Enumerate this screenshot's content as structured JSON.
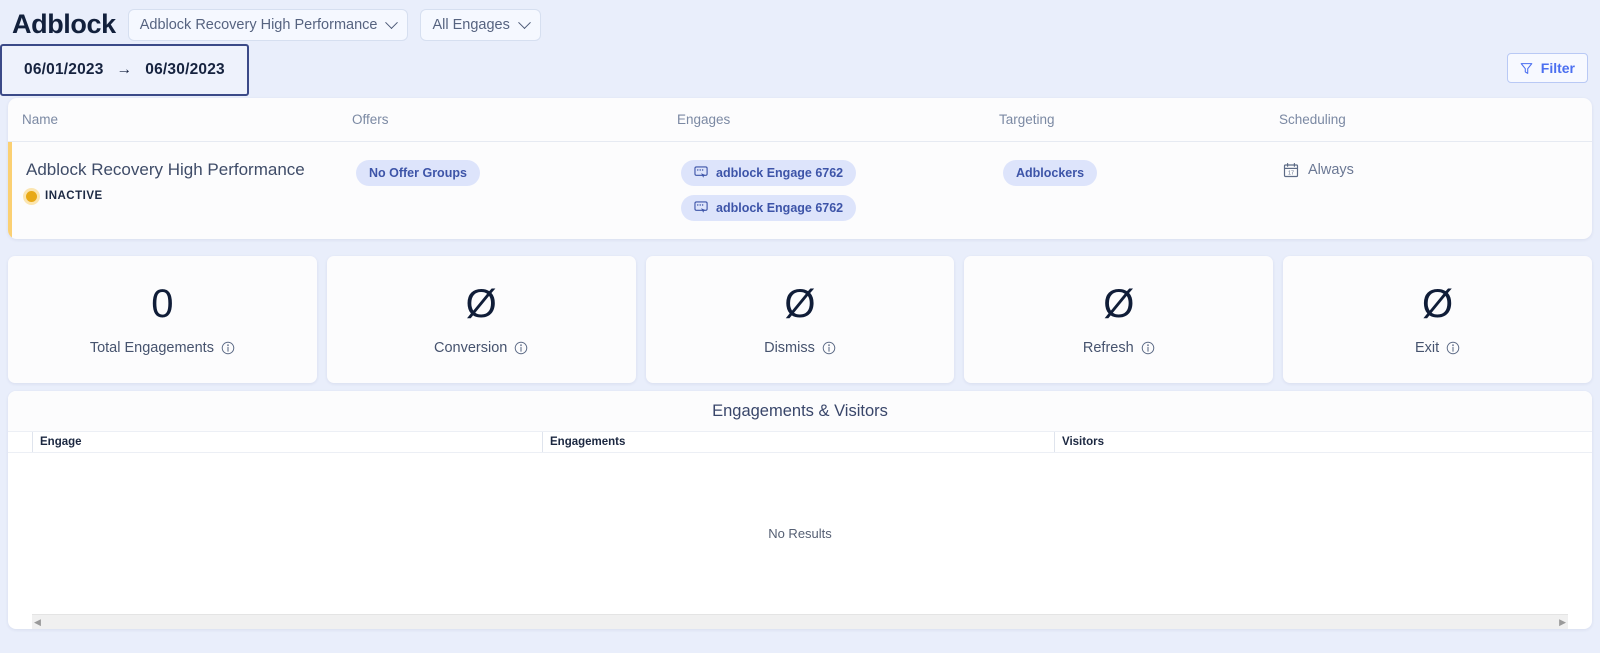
{
  "header": {
    "app_title": "Adblock",
    "campaign_select": "Adblock Recovery High Performance",
    "engage_select": "All Engages",
    "date_start": "06/01/2023",
    "date_arrow": "→",
    "date_end": "06/30/2023",
    "filter_label": "Filter"
  },
  "table": {
    "columns": [
      "Name",
      "Offers",
      "Engages",
      "Targeting",
      "Scheduling"
    ],
    "row": {
      "name": "Adblock Recovery High Performance",
      "status": "INACTIVE",
      "offers_badge": "No Offer Groups",
      "engages": [
        "adblock Engage 6762",
        "adblock Engage 6762"
      ],
      "targeting_badge": "Adblockers",
      "scheduling": "Always"
    }
  },
  "stats": [
    {
      "value": "0",
      "label": "Total Engagements"
    },
    {
      "value": "Ø",
      "label": "Conversion"
    },
    {
      "value": "Ø",
      "label": "Dismiss"
    },
    {
      "value": "Ø",
      "label": "Refresh"
    },
    {
      "value": "Ø",
      "label": "Exit"
    }
  ],
  "bottom": {
    "title": "Engagements & Visitors",
    "columns": [
      "Engage",
      "Engagements",
      "Visitors"
    ],
    "empty_message": "No Results",
    "scroll_left": "◀",
    "scroll_right": "▶"
  },
  "colors": {
    "background": "#e9eefb",
    "accent_blue": "#4b6ff0",
    "badge_bg": "#dde4fb",
    "badge_text": "#3d54a8",
    "status_amber": "#e8a917",
    "date_border": "#3b4a88"
  }
}
